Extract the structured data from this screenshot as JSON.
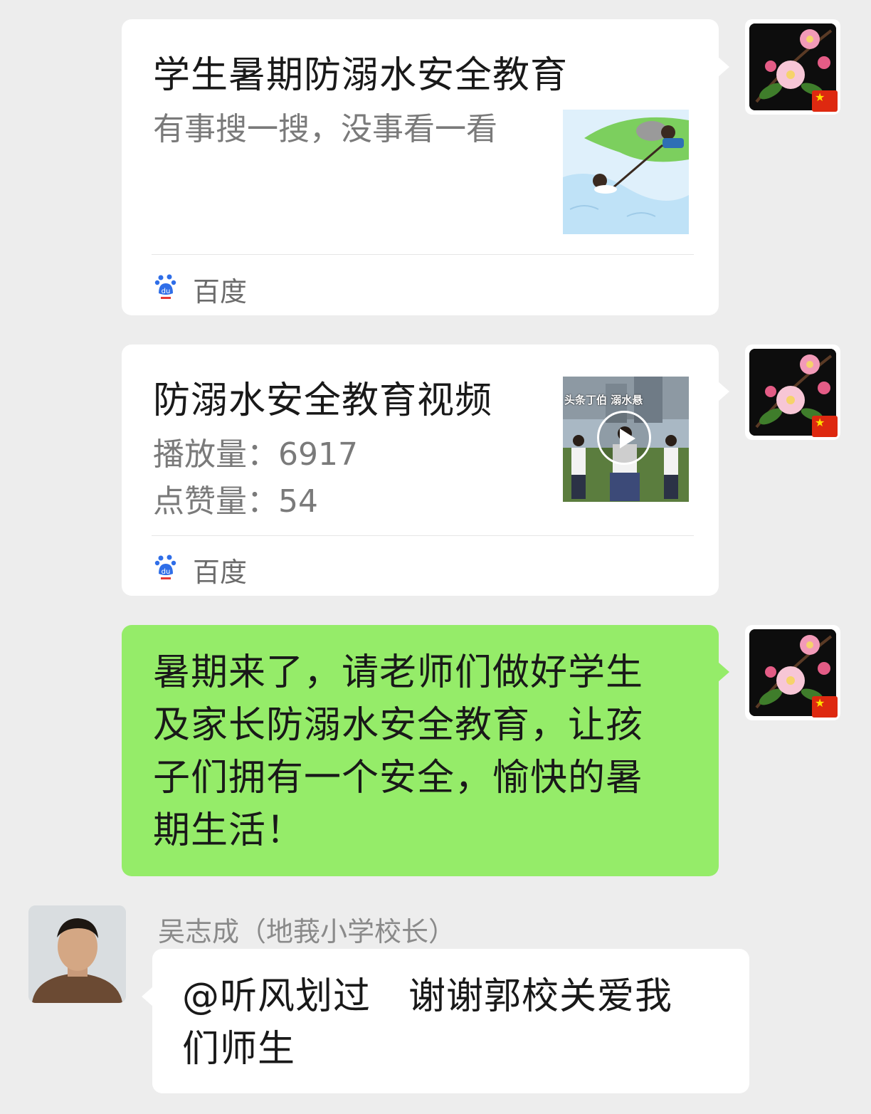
{
  "messages": [
    {
      "type": "link-card",
      "title": "学生暑期防溺水安全教育",
      "description": "有事搜一搜，没事看一看",
      "source": "百度",
      "source_icon": "baidu-paw-icon"
    },
    {
      "type": "video-card",
      "title": "防溺水安全教育视频",
      "plays_label": "播放量：",
      "plays_value": "6917",
      "likes_label": "点赞量：",
      "likes_value": "54",
      "thumbnail_caption": "头条丁伯  溺水悬",
      "source": "百度",
      "source_icon": "baidu-paw-icon"
    },
    {
      "type": "text",
      "lines": [
        "暑期来了，请老师们做好学生",
        "及家长防溺水安全教育，让孩",
        "子们拥有一个安全，愉快的暑",
        "期生活！"
      ]
    },
    {
      "type": "incoming-text",
      "sender": "吴志成（地莪小学校长）",
      "lines": [
        "@听风划过　谢谢郭校关爱我",
        "们师生"
      ]
    }
  ],
  "colors": {
    "background": "#ededed",
    "self_bubble": "#95ec69",
    "card": "#ffffff"
  }
}
